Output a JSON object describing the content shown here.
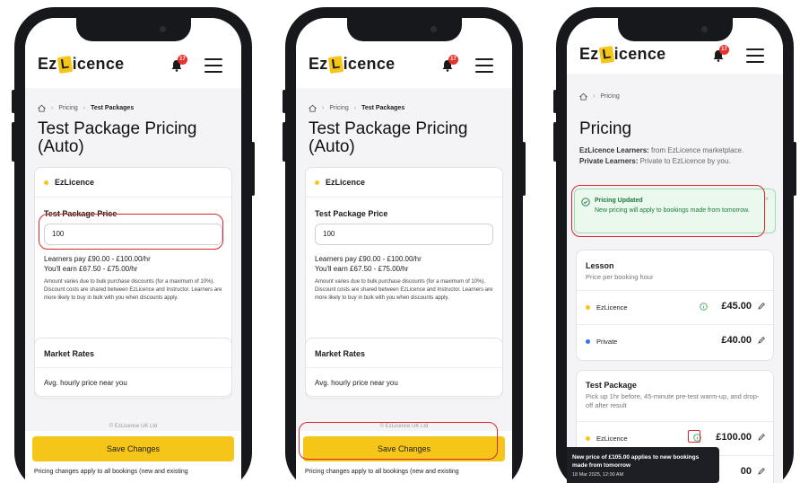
{
  "brand": {
    "name_prefix": "Ez",
    "name_letter": "L",
    "name_suffix": "icence",
    "accent": "#f5c518",
    "alert_red": "#d8282d"
  },
  "notifications": {
    "count": "17"
  },
  "phone1": {
    "breadcrumb": [
      "Pricing",
      "Test Packages"
    ],
    "title": "Test Package Pricing (Auto)",
    "card": {
      "provider": "EzLicence",
      "price_label": "Test Package Price",
      "price_value": "100",
      "learners_pay": "Learners pay £90.00 - £100.00/hr",
      "you_earn": "You'll earn £67.50 - £75.00/hr",
      "note": "Amount varies due to bulk purchase discounts (for a maximum of 10%). Discount costs are shared between EzLicence and Instructor. Learners are more likely to buy in bulk with you when discounts apply."
    },
    "market": {
      "title": "Market Rates",
      "row": "Avg. hourly price near you"
    },
    "footer": "© EzLicence UK Ltd",
    "save_label": "Save Changes",
    "save_note": "Pricing changes apply to all bookings (new and existing"
  },
  "phone2": {
    "breadcrumb": [
      "Pricing",
      "Test Packages"
    ],
    "title": "Test Package Pricing (Auto)",
    "card": {
      "provider": "EzLicence",
      "price_label": "Test Package Price",
      "price_value": "100",
      "learners_pay": "Learners pay £90.00 - £100.00/hr",
      "you_earn": "You'll earn £67.50 - £75.00/hr",
      "note": "Amount varies due to bulk purchase discounts (for a maximum of 10%). Discount costs are shared between EzLicence and Instructor. Learners are more likely to buy in bulk with you when discounts apply."
    },
    "market": {
      "title": "Market Rates",
      "row": "Avg. hourly price near you"
    },
    "footer": "© EzLicence UK Ltd",
    "save_label": "Save Changes",
    "save_note": "Pricing changes apply to all bookings (new and existing"
  },
  "phone3": {
    "breadcrumb": [
      "Pricing"
    ],
    "title": "Pricing",
    "desc_learners_b": "EzLicence Learners:",
    "desc_learners": " from EzLicence marketplace.",
    "desc_private_b": "Private Learners:",
    "desc_private": " Private to EzLicence by you.",
    "alert": {
      "title": "Pricing Updated",
      "body": "New pricing will apply to bookings made from tomorrow."
    },
    "lesson": {
      "title": "Lesson",
      "subtitle": "Price per booking hour",
      "rows": [
        {
          "name": "EzLicence",
          "price": "£45.00"
        },
        {
          "name": "Private",
          "price": "£40.00"
        }
      ]
    },
    "test": {
      "title": "Test Package",
      "subtitle": "Pick up 1hr before, 45-minute pre-test warm-up, and drop-off after result",
      "rows": [
        {
          "name": "EzLicence",
          "price": "£100.00"
        },
        {
          "name": "",
          "price": "00"
        }
      ]
    },
    "tooltip": {
      "message": "New price of £105.00 applies to new bookings made from tomorrow",
      "date": "18 Mar 2025, 12:00 AM"
    }
  }
}
